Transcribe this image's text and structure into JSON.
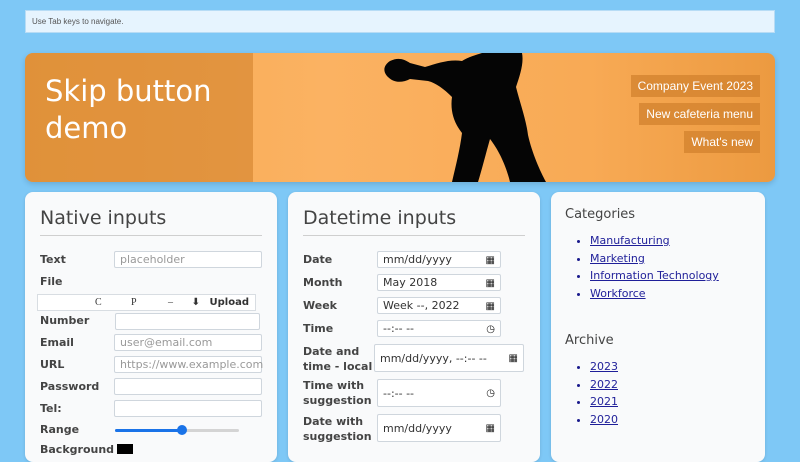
{
  "skip": {
    "text": "Use Tab keys to navigate."
  },
  "banner": {
    "title": "Skip button demo",
    "links": [
      "Company Event 2023",
      "New cafeteria menu",
      "What's new"
    ]
  },
  "native": {
    "title": "Native inputs",
    "text_label": "Text",
    "text_placeholder": "placeholder",
    "file_label": "File",
    "file_chars": [
      "C",
      "P",
      "–"
    ],
    "upload_label": "Upload",
    "number_label": "Number",
    "email_label": "Email",
    "email_placeholder": "user@email.com",
    "url_label": "URL",
    "url_placeholder": "https://www.example.com",
    "password_label": "Password",
    "tel_label": "Tel:",
    "range_label": "Range",
    "range_value": 0.54,
    "background_label": "Background",
    "background_color": "#000000"
  },
  "datetime": {
    "title": "Datetime inputs",
    "date_label": "Date",
    "date_value": "mm/dd/yyyy",
    "month_label": "Month",
    "month_value": "May 2018",
    "week_label": "Week",
    "week_value": "Week --, 2022",
    "time_label": "Time",
    "time_value": "--:-- --",
    "dtlocal_label": "Date and time - local",
    "dtlocal_value": "mm/dd/yyyy, --:-- --",
    "time_sugg_label": "Time with suggestion",
    "time_sugg_value": "--:-- --",
    "date_sugg_label": "Date with suggestion",
    "date_sugg_value": "mm/dd/yyyy"
  },
  "sidebar": {
    "categories_title": "Categories",
    "categories": [
      "Manufacturing",
      "Marketing",
      "Information Technology",
      "Workforce"
    ],
    "archive_title": "Archive",
    "archive": [
      "2023",
      "2022",
      "2021",
      "2020"
    ]
  },
  "colors": {
    "page_bg": "#7ec8f6",
    "accent": "#1a73e8",
    "banner": "#f8aa55"
  }
}
